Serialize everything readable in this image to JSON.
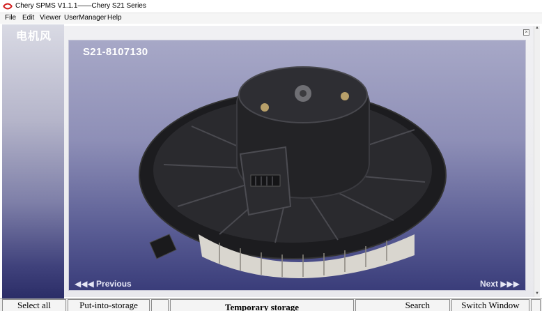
{
  "window": {
    "title": "Chery SPMS V1.1.1——Chery S21 Series",
    "icon": "chery-logo-icon"
  },
  "menu": {
    "items": [
      "File",
      "Edit",
      "Viewer",
      "UserManager",
      "Help"
    ]
  },
  "left_panel": {
    "title": "电机风"
  },
  "viewer": {
    "part_code": "S21-8107130",
    "previous_label": "◀◀◀ Previous",
    "next_label": "Next ▶▶▶",
    "close_symbol": "×"
  },
  "bottom_bar": {
    "select_all": "Select all",
    "put_into_storage": "Put-into-storage",
    "temporary_storage": "Temporary storage",
    "search": "Search",
    "switch_window": "Switch Window"
  },
  "colors": {
    "accent_red": "#d11a1a",
    "panel_dark": "#2b2d67",
    "frame_top": "#a7a8c7"
  }
}
